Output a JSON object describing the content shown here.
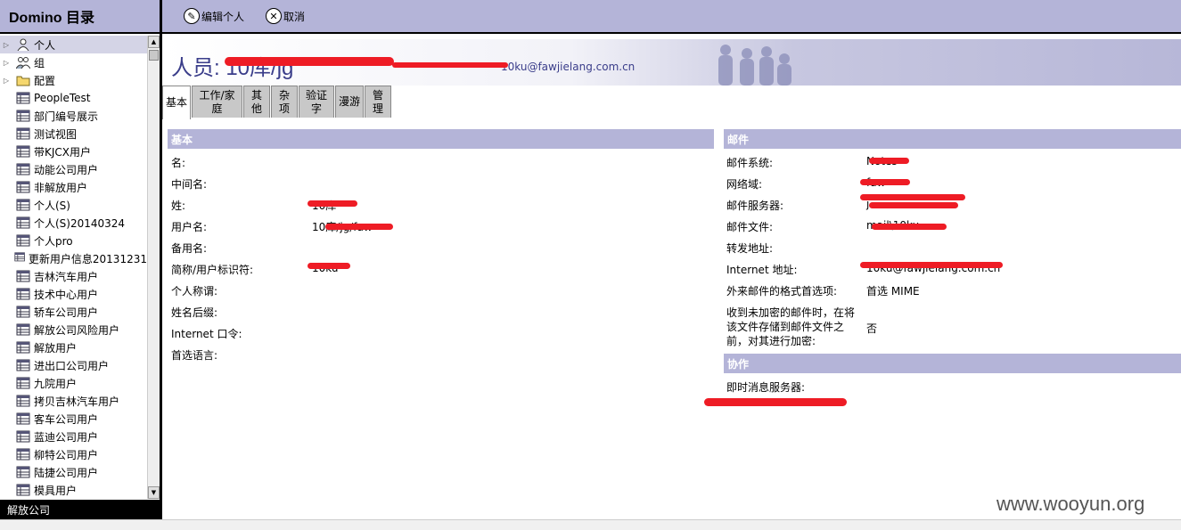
{
  "left_pane": {
    "title": "Domino 目录",
    "items": [
      {
        "label": "个人",
        "icon": "person-icon",
        "twisty": true,
        "selected": true
      },
      {
        "label": "组",
        "icon": "group-icon",
        "twisty": true,
        "selected": false
      },
      {
        "label": "配置",
        "icon": "folder-icon",
        "twisty": true,
        "selected": false
      },
      {
        "label": "PeopleTest",
        "icon": "view-icon",
        "twisty": false,
        "selected": false
      },
      {
        "label": "部门编号展示",
        "icon": "view-icon",
        "twisty": false,
        "selected": false
      },
      {
        "label": "测试视图",
        "icon": "view-icon",
        "twisty": false,
        "selected": false
      },
      {
        "label": "带KJCX用户",
        "icon": "view-icon",
        "twisty": false,
        "selected": false
      },
      {
        "label": "动能公司用户",
        "icon": "view-icon",
        "twisty": false,
        "selected": false
      },
      {
        "label": "非解放用户",
        "icon": "view-icon",
        "twisty": false,
        "selected": false
      },
      {
        "label": "个人(S)",
        "icon": "view-icon",
        "twisty": false,
        "selected": false
      },
      {
        "label": "个人(S)20140324",
        "icon": "view-icon",
        "twisty": false,
        "selected": false
      },
      {
        "label": "个人pro",
        "icon": "view-icon",
        "twisty": false,
        "selected": false
      },
      {
        "label": "更新用户信息20131231",
        "icon": "view-icon",
        "twisty": false,
        "selected": false
      },
      {
        "label": "吉林汽车用户",
        "icon": "view-icon",
        "twisty": false,
        "selected": false
      },
      {
        "label": "技术中心用户",
        "icon": "view-icon",
        "twisty": false,
        "selected": false
      },
      {
        "label": "轿车公司用户",
        "icon": "view-icon",
        "twisty": false,
        "selected": false
      },
      {
        "label": "解放公司风险用户",
        "icon": "view-icon",
        "twisty": false,
        "selected": false
      },
      {
        "label": "解放用户",
        "icon": "view-icon",
        "twisty": false,
        "selected": false
      },
      {
        "label": "进出口公司用户",
        "icon": "view-icon",
        "twisty": false,
        "selected": false
      },
      {
        "label": "九院用户",
        "icon": "view-icon",
        "twisty": false,
        "selected": false
      },
      {
        "label": "拷贝吉林汽车用户",
        "icon": "view-icon",
        "twisty": false,
        "selected": false
      },
      {
        "label": "客车公司用户",
        "icon": "view-icon",
        "twisty": false,
        "selected": false
      },
      {
        "label": "蓝迪公司用户",
        "icon": "view-icon",
        "twisty": false,
        "selected": false
      },
      {
        "label": "柳特公司用户",
        "icon": "view-icon",
        "twisty": false,
        "selected": false
      },
      {
        "label": "陆捷公司用户",
        "icon": "view-icon",
        "twisty": false,
        "selected": false
      },
      {
        "label": "模具用户",
        "icon": "view-icon",
        "twisty": false,
        "selected": false
      }
    ],
    "status_text": "解放公司"
  },
  "toolbar": {
    "edit_label": "编辑个人",
    "cancel_label": "取消"
  },
  "banner": {
    "title": "人员: 10库/jg",
    "email": "10ku@fawjielang.com.cn"
  },
  "tabs": [
    {
      "label": "基本",
      "active": true
    },
    {
      "label": "工作/家庭",
      "active": false
    },
    {
      "label": "其他",
      "active": false
    },
    {
      "label": "杂项",
      "active": false
    },
    {
      "label": "验证字",
      "active": false
    },
    {
      "label": "漫游",
      "active": false
    },
    {
      "label": "管理",
      "active": false
    }
  ],
  "basic_section": {
    "heading": "基本",
    "fields": [
      {
        "label": "名:",
        "value": ""
      },
      {
        "label": "中间名:",
        "value": ""
      },
      {
        "label": "姓:",
        "value": "10库"
      },
      {
        "label": "用户名:",
        "value": "10库/jg/faw"
      },
      {
        "label": "备用名:",
        "value": ""
      },
      {
        "label": "简称/用户标识符:",
        "value": "10ku"
      },
      {
        "label": "个人称谓:",
        "value": ""
      },
      {
        "label": "姓名后缀:",
        "value": ""
      },
      {
        "label": "Internet 口令:",
        "value": ""
      },
      {
        "label": "首选语言:",
        "value": ""
      }
    ]
  },
  "mail_section": {
    "heading": "邮件",
    "fields": [
      {
        "label": "邮件系统:",
        "value": "Notes"
      },
      {
        "label": "网络域:",
        "value": "faw"
      },
      {
        "label": "邮件服务器:",
        "value": "j"
      },
      {
        "label": "邮件文件:",
        "value": "mail\\10ku"
      },
      {
        "label": "转发地址:",
        "value": ""
      },
      {
        "label": "Internet 地址:",
        "value": "10ku@fawjielang.com.cn"
      },
      {
        "label": "外来邮件的格式首选项:",
        "value": "首选 MIME"
      },
      {
        "label": "收到未加密的邮件时，在将该文件存储到邮件文件之前，对其进行加密:",
        "value": "否"
      }
    ]
  },
  "collab_section": {
    "heading": "协作",
    "fields": [
      {
        "label": "即时消息服务器:",
        "value": ""
      }
    ]
  },
  "watermark": "www.wooyun.org",
  "colors": {
    "header_band": "#b4b4d8",
    "title_text": "#3a3d8a",
    "redaction": "#ee1c25"
  }
}
